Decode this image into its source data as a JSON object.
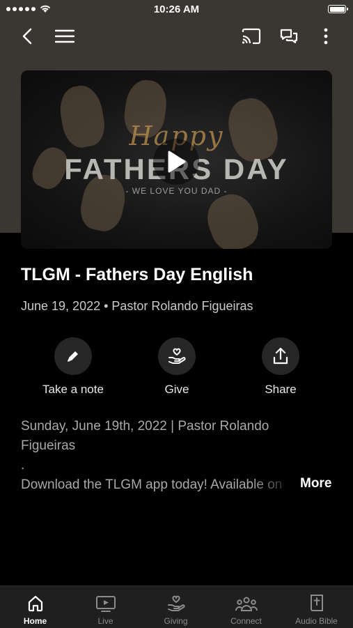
{
  "status_bar": {
    "time": "10:26 AM"
  },
  "nav": {
    "back_icon": "chevron-left-icon",
    "menu_icon": "hamburger-icon",
    "cast_icon": "cast-icon",
    "chat_icon": "chat-icon",
    "more_icon": "more-vertical-icon"
  },
  "hero": {
    "script_text": "Happy",
    "headline": "FATHERS DAY",
    "tagline": "- WE LOVE YOU DAD -"
  },
  "sermon": {
    "title": "TLGM - Fathers Day English",
    "meta": "June 19, 2022 • Pastor Rolando Figueiras"
  },
  "actions": [
    {
      "label": "Take a note",
      "icon": "pencil-icon"
    },
    {
      "label": "Give",
      "icon": "heart-hand-icon"
    },
    {
      "label": "Share",
      "icon": "share-icon"
    }
  ],
  "description": {
    "line1": "Sunday, June 19th, 2022 | Pastor Rolando",
    "line2": "Figueiras",
    "line3": ".",
    "line4": "Download the TLGM app today! Available on",
    "more_label": "More"
  },
  "tabs": [
    {
      "label": "Home",
      "icon": "home-icon",
      "active": true
    },
    {
      "label": "Live",
      "icon": "tv-icon",
      "active": false
    },
    {
      "label": "Giving",
      "icon": "giving-icon",
      "active": false
    },
    {
      "label": "Connect",
      "icon": "people-icon",
      "active": false
    },
    {
      "label": "Audio Bible",
      "icon": "bible-icon",
      "active": false
    }
  ],
  "colors": {
    "header_bg": "#3a3631",
    "page_bg": "#000000",
    "tabbar_bg": "#1f1f1f",
    "accent": "#ffffff"
  }
}
